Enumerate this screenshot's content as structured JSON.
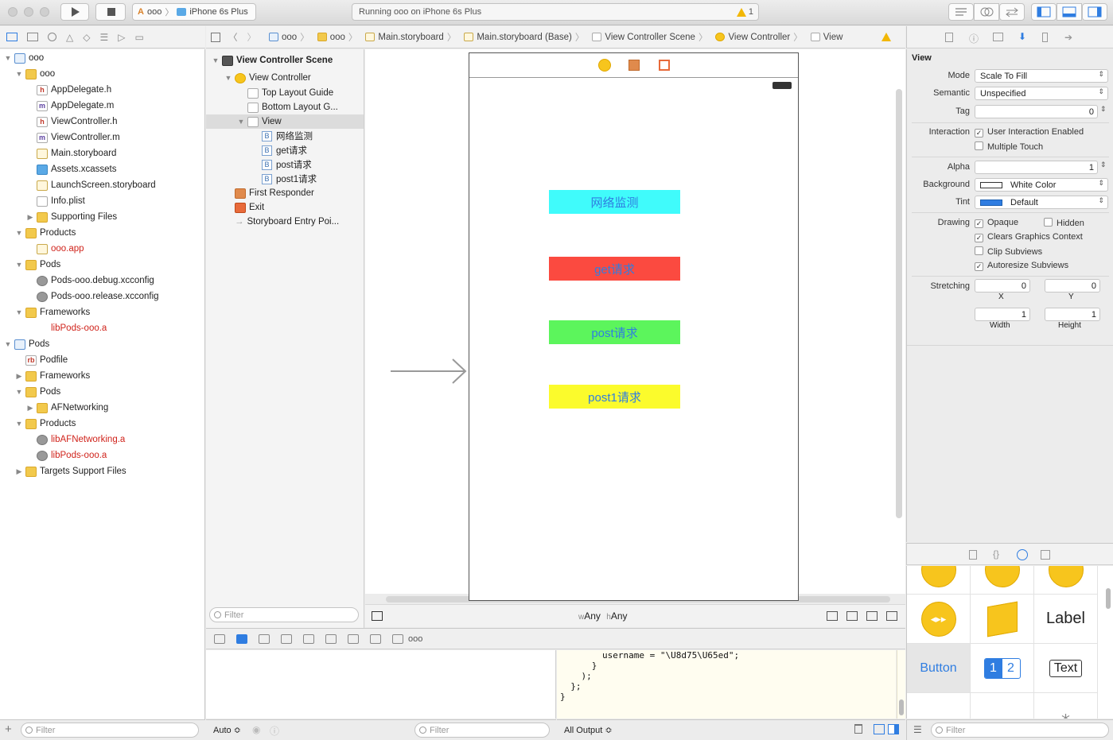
{
  "toolbar": {
    "scheme_project": "ooo",
    "scheme_device": "iPhone 6s Plus",
    "activity_text": "Running ooo on iPhone 6s Plus",
    "warning_count": "1"
  },
  "navigator": {
    "items": [
      {
        "label": "ooo",
        "level": 0,
        "disc": "▼",
        "icon": "proj"
      },
      {
        "label": "ooo",
        "level": 1,
        "disc": "▼",
        "icon": "folder"
      },
      {
        "label": "AppDelegate.h",
        "level": 2,
        "disc": "",
        "icon": "h"
      },
      {
        "label": "AppDelegate.m",
        "level": 2,
        "disc": "",
        "icon": "m"
      },
      {
        "label": "ViewController.h",
        "level": 2,
        "disc": "",
        "icon": "h"
      },
      {
        "label": "ViewController.m",
        "level": 2,
        "disc": "",
        "icon": "m"
      },
      {
        "label": "Main.storyboard",
        "level": 2,
        "disc": "",
        "icon": "sb"
      },
      {
        "label": "Assets.xcassets",
        "level": 2,
        "disc": "",
        "icon": "xc"
      },
      {
        "label": "LaunchScreen.storyboard",
        "level": 2,
        "disc": "",
        "icon": "sb"
      },
      {
        "label": "Info.plist",
        "level": 2,
        "disc": "",
        "icon": "pl"
      },
      {
        "label": "Supporting Files",
        "level": 2,
        "disc": "▶",
        "icon": "folder"
      },
      {
        "label": "Products",
        "level": 1,
        "disc": "▼",
        "icon": "folder"
      },
      {
        "label": "ooo.app",
        "level": 2,
        "disc": "",
        "icon": "app",
        "red": true
      },
      {
        "label": "Pods",
        "level": 1,
        "disc": "▼",
        "icon": "folder"
      },
      {
        "label": "Pods-ooo.debug.xcconfig",
        "level": 2,
        "disc": "",
        "icon": "gear"
      },
      {
        "label": "Pods-ooo.release.xcconfig",
        "level": 2,
        "disc": "",
        "icon": "gear"
      },
      {
        "label": "Frameworks",
        "level": 1,
        "disc": "▼",
        "icon": "folder"
      },
      {
        "label": "libPods-ooo.a",
        "level": 2,
        "disc": "",
        "icon": "none",
        "red": true
      },
      {
        "label": "Pods",
        "level": 0,
        "disc": "▼",
        "icon": "proj"
      },
      {
        "label": "Podfile",
        "level": 1,
        "disc": "",
        "icon": "rb"
      },
      {
        "label": "Frameworks",
        "level": 1,
        "disc": "▶",
        "icon": "folder"
      },
      {
        "label": "Pods",
        "level": 1,
        "disc": "▼",
        "icon": "folder"
      },
      {
        "label": "AFNetworking",
        "level": 2,
        "disc": "▶",
        "icon": "folder"
      },
      {
        "label": "Products",
        "level": 1,
        "disc": "▼",
        "icon": "folder"
      },
      {
        "label": "libAFNetworking.a",
        "level": 2,
        "disc": "",
        "icon": "lib",
        "red": true
      },
      {
        "label": "libPods-ooo.a",
        "level": 2,
        "disc": "",
        "icon": "lib",
        "red": true
      },
      {
        "label": "Targets Support Files",
        "level": 1,
        "disc": "▶",
        "icon": "folder"
      }
    ],
    "filter_placeholder": "Filter"
  },
  "jumpbar": {
    "crumbs": [
      "ooo",
      "ooo",
      "Main.storyboard",
      "Main.storyboard (Base)",
      "View Controller Scene",
      "View Controller",
      "View"
    ]
  },
  "outline": {
    "scene_title": "View Controller Scene",
    "view_controller": "View Controller",
    "top_layout": "Top Layout Guide",
    "bottom_layout": "Bottom Layout G...",
    "view": "View",
    "children": [
      "网络监测",
      "get请求",
      "post请求",
      "post1请求"
    ],
    "first_responder": "First Responder",
    "exit": "Exit",
    "entry_point": "Storyboard Entry Poi...",
    "filter_placeholder": "Filter"
  },
  "canvas": {
    "buttons": [
      {
        "label": "网络监测",
        "color": "#40fbfb"
      },
      {
        "label": "get请求",
        "color": "#fb4a40"
      },
      {
        "label": "post请求",
        "color": "#5cf55c"
      },
      {
        "label": "post1请求",
        "color": "#fbfb2c"
      }
    ],
    "size_w_prefix": "w",
    "size_w": "Any",
    "size_h_prefix": "h",
    "size_h": "Any"
  },
  "debug": {
    "process": "ooo",
    "console_lines": [
      "        username = \"\\U8d75\\U65ed\";",
      "      }",
      "    );",
      "  };",
      "}"
    ],
    "auto_label": "Auto ≎",
    "filter_placeholder": "Filter",
    "output_label": "All Output ≎"
  },
  "inspector": {
    "section": "View",
    "mode_label": "Mode",
    "mode_value": "Scale To Fill",
    "semantic_label": "Semantic",
    "semantic_value": "Unspecified",
    "tag_label": "Tag",
    "tag_value": "0",
    "interaction_label": "Interaction",
    "user_interaction": "User Interaction Enabled",
    "multiple_touch": "Multiple Touch",
    "alpha_label": "Alpha",
    "alpha_value": "1",
    "background_label": "Background",
    "background_value": "White Color",
    "tint_label": "Tint",
    "tint_value": "Default",
    "drawing_label": "Drawing",
    "opaque": "Opaque",
    "hidden": "Hidden",
    "clears": "Clears Graphics Context",
    "clip": "Clip Subviews",
    "autoresize": "Autoresize Subviews",
    "stretching_label": "Stretching",
    "stretch_x": "0",
    "stretch_y": "0",
    "stretch_w": "1",
    "stretch_h": "1",
    "x_label": "X",
    "y_label": "Y",
    "width_label": "Width",
    "height_label": "Height",
    "tint_color": "#2f7de1"
  },
  "library": {
    "label_text": "Label",
    "button_text": "Button",
    "seg_1": "1",
    "seg_2": "2",
    "text_field": "Text",
    "filter_placeholder": "Filter"
  }
}
